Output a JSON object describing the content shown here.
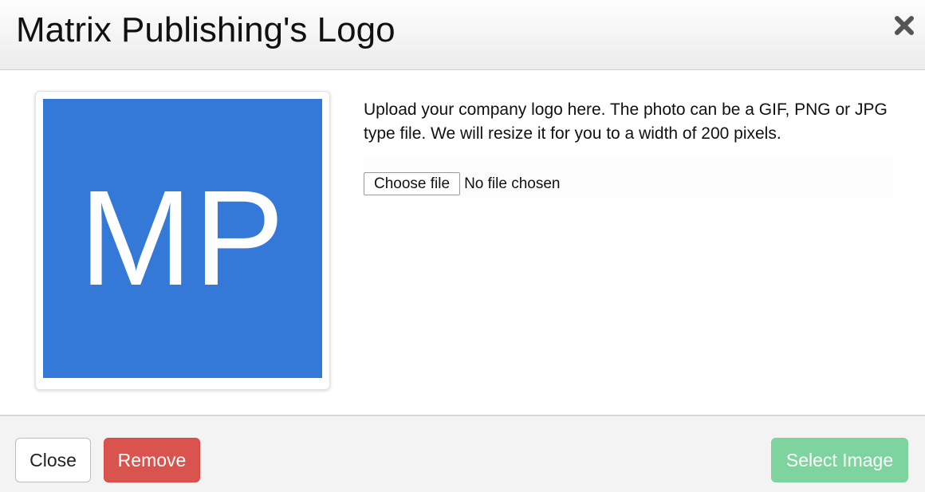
{
  "dialog": {
    "title": "Matrix Publishing's Logo",
    "close_icon": "close-x-icon"
  },
  "logo": {
    "initials": "MP",
    "background_color": "#3478d8",
    "text_color": "#ffffff"
  },
  "upload": {
    "description": "Upload your company logo here. The photo can be a GIF, PNG or JPG type file. We will resize it for you to a width of 200 pixels.",
    "choose_file_label": "Choose file",
    "file_status": "No file chosen"
  },
  "footer": {
    "close_label": "Close",
    "remove_label": "Remove",
    "remove_color": "#d9534f",
    "select_label": "Select Image",
    "select_color": "#7dd49e"
  }
}
